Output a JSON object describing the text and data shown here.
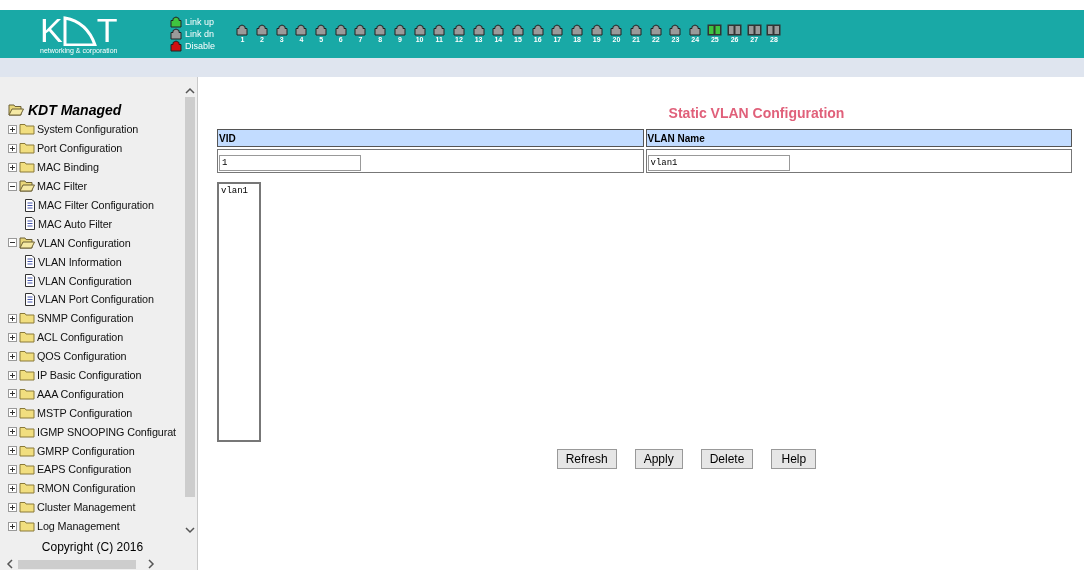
{
  "header": {
    "logo": {
      "left": "K",
      "right": "T",
      "tagline": "networking & corporation"
    },
    "legend": [
      {
        "label": "Link up",
        "color": "#3fc43f"
      },
      {
        "label": "Link dn",
        "color": "#9a9a9a"
      },
      {
        "label": "Disable",
        "color": "#d01010"
      }
    ],
    "ports": [
      {
        "label": "1",
        "kind": "single",
        "up": false
      },
      {
        "label": "2",
        "kind": "single",
        "up": false
      },
      {
        "label": "3",
        "kind": "single",
        "up": false
      },
      {
        "label": "4",
        "kind": "single",
        "up": false
      },
      {
        "label": "5",
        "kind": "single",
        "up": false
      },
      {
        "label": "6",
        "kind": "single",
        "up": false
      },
      {
        "label": "7",
        "kind": "single",
        "up": false
      },
      {
        "label": "8",
        "kind": "single",
        "up": false
      },
      {
        "label": "9",
        "kind": "single",
        "up": false
      },
      {
        "label": "10",
        "kind": "single",
        "up": false
      },
      {
        "label": "11",
        "kind": "single",
        "up": false
      },
      {
        "label": "12",
        "kind": "single",
        "up": false
      },
      {
        "label": "13",
        "kind": "single",
        "up": false
      },
      {
        "label": "14",
        "kind": "single",
        "up": false
      },
      {
        "label": "15",
        "kind": "single",
        "up": false
      },
      {
        "label": "16",
        "kind": "single",
        "up": false
      },
      {
        "label": "17",
        "kind": "single",
        "up": false
      },
      {
        "label": "18",
        "kind": "single",
        "up": false
      },
      {
        "label": "19",
        "kind": "single",
        "up": false
      },
      {
        "label": "20",
        "kind": "single",
        "up": false
      },
      {
        "label": "21",
        "kind": "single",
        "up": false
      },
      {
        "label": "22",
        "kind": "single",
        "up": false
      },
      {
        "label": "23",
        "kind": "single",
        "up": false
      },
      {
        "label": "24",
        "kind": "single",
        "up": false
      },
      {
        "label": "25",
        "kind": "dual",
        "up": true
      },
      {
        "label": "26",
        "kind": "dual",
        "up": false
      },
      {
        "label": "27",
        "kind": "dual",
        "up": false
      },
      {
        "label": "28",
        "kind": "dual",
        "up": false
      }
    ]
  },
  "sidebar": {
    "root": {
      "label": "KDT Managed",
      "expanded": true
    },
    "items": [
      {
        "label": "System Configuration",
        "kind": "folder",
        "expanded": false
      },
      {
        "label": "Port Configuration",
        "kind": "folder",
        "expanded": false
      },
      {
        "label": "MAC Binding",
        "kind": "folder",
        "expanded": false
      },
      {
        "label": "MAC Filter",
        "kind": "folder",
        "expanded": true,
        "children": [
          {
            "label": "MAC Filter Configuration",
            "kind": "page"
          },
          {
            "label": "MAC Auto Filter",
            "kind": "page"
          }
        ]
      },
      {
        "label": "VLAN Configuration",
        "kind": "folder",
        "expanded": true,
        "children": [
          {
            "label": "VLAN Information",
            "kind": "page"
          },
          {
            "label": "VLAN Configuration",
            "kind": "page"
          },
          {
            "label": "VLAN Port Configuration",
            "kind": "page"
          }
        ]
      },
      {
        "label": "SNMP Configuration",
        "kind": "folder",
        "expanded": false
      },
      {
        "label": "ACL Configuration",
        "kind": "folder",
        "expanded": false
      },
      {
        "label": "QOS Configuration",
        "kind": "folder",
        "expanded": false
      },
      {
        "label": "IP Basic Configuration",
        "kind": "folder",
        "expanded": false
      },
      {
        "label": "AAA Configuration",
        "kind": "folder",
        "expanded": false
      },
      {
        "label": "MSTP Configuration",
        "kind": "folder",
        "expanded": false
      },
      {
        "label": "IGMP SNOOPING Configurat",
        "kind": "folder",
        "expanded": false
      },
      {
        "label": "GMRP Configuration",
        "kind": "folder",
        "expanded": false
      },
      {
        "label": "EAPS Configuration",
        "kind": "folder",
        "expanded": false
      },
      {
        "label": "RMON Configuration",
        "kind": "folder",
        "expanded": false
      },
      {
        "label": "Cluster Management",
        "kind": "folder",
        "expanded": false
      },
      {
        "label": "Log Management",
        "kind": "folder",
        "expanded": false
      }
    ],
    "copyright": "Copyright (C) 2016"
  },
  "main": {
    "title": "Static VLAN Configuration",
    "table": {
      "columns": [
        "VID",
        "VLAN Name"
      ],
      "values": [
        "1",
        "vlan1"
      ]
    },
    "vlan_list": [
      {
        "label": "vlan1",
        "selected": false
      }
    ],
    "buttons": [
      "Refresh",
      "Apply",
      "Delete",
      "Help"
    ]
  }
}
